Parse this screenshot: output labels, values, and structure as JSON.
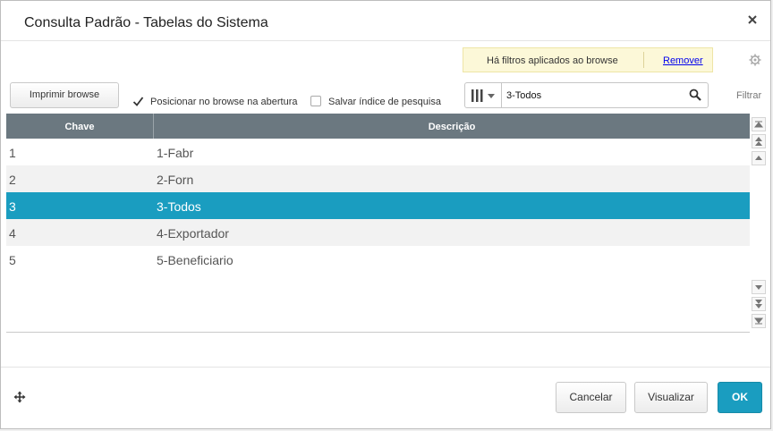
{
  "dialog": {
    "title": "Consulta Padrão - Tabelas do Sistema"
  },
  "filter_banner": {
    "message": "Há filtros aplicados ao browse",
    "remove_label": "Remover"
  },
  "toolbar": {
    "print_label": "Imprimir browse",
    "position_checkbox_label": "Posicionar no browse na abertura",
    "position_checkbox_checked": true,
    "save_index_label": "Salvar índice de pesquisa",
    "save_index_checked": false,
    "search_value": "3-Todos",
    "filter_label": "Filtrar"
  },
  "grid": {
    "columns": [
      "Chave",
      "Descrição"
    ],
    "rows": [
      {
        "key": "1",
        "desc": "1-Fabr"
      },
      {
        "key": "2",
        "desc": "2-Forn"
      },
      {
        "key": "3",
        "desc": "3-Todos"
      },
      {
        "key": "4",
        "desc": "4-Exportador"
      },
      {
        "key": "5",
        "desc": "5-Beneficiario"
      }
    ],
    "selected_row": 3
  },
  "footer": {
    "cancel_label": "Cancelar",
    "view_label": "Visualizar",
    "ok_label": "OK"
  },
  "colors": {
    "accent": "#1a9dc0",
    "header": "#6b7880",
    "banner": "#fcf8d8"
  },
  "icons": [
    "close-icon",
    "gear-icon",
    "columns-icon",
    "search-icon",
    "scroll-up-icons",
    "scroll-down-icons",
    "move-icon",
    "checkmark-icon"
  ]
}
